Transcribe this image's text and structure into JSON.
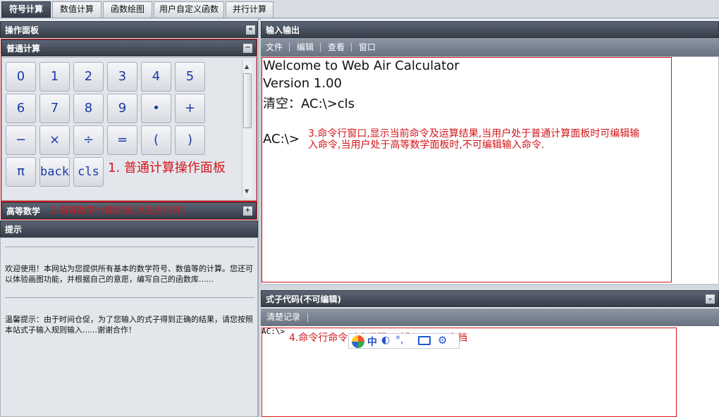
{
  "tabs": [
    "符号计算",
    "数值计算",
    "函数绘图",
    "用户自定义函数",
    "并行计算"
  ],
  "left": {
    "panel_title": "操作面板",
    "basic_title": "普通计算",
    "keys": [
      "0",
      "1",
      "2",
      "3",
      "4",
      "5",
      "6",
      "7",
      "8",
      "9",
      "•",
      "+",
      "−",
      "×",
      "÷",
      "=",
      "(",
      ")",
      "π",
      "back",
      "cls"
    ],
    "basic_annotation": "1. 普通计算操作面板",
    "advanced_title": "高等数学",
    "advanced_annotation": "2.高等数学计算面板(点击后打开)",
    "tips_title": "提示",
    "tip1": "欢迎使用！本网站为您提供所有基本的数学符号、数值等的计算。您还可以体验画图功能，并根据自己的意愿，编写自己的函数库......",
    "tip2": "温馨提示：由于时间仓促，为了您输入的式子得到正确的结果，请您按照本站式子输入规则输入......谢谢合作！"
  },
  "io": {
    "title": "输入输出",
    "menu": [
      "文件",
      "编辑",
      "查看",
      "窗口"
    ],
    "lines": [
      "Welcome to Web Air Calculator",
      "Version 1.00",
      "清空：AC:\\>cls",
      "AC:\\>"
    ],
    "annotation": "3.命令行窗口,显示当前命令及运算结果,当用户处于普通计算面板时可编辑输入命令,当用户处于高等数学面板时,不可编辑输入命令."
  },
  "code": {
    "title": "式子代码(不可编辑)",
    "clear_label": "清楚记录",
    "prompt": "AC:\\>",
    "annotation": "4.命令行命令对应代码,可插入LaTex文档"
  },
  "colors": {
    "annotation": "#d2161b",
    "key_text": "#1a3aa8",
    "header_dark": "#363d48"
  }
}
